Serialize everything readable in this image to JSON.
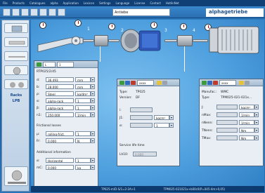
{
  "menu": [
    "File",
    "Products",
    "Catalogues",
    "alpha",
    "Application",
    "Lexicon",
    "Settings",
    "Language",
    "License",
    "Contact",
    "HotlinNet"
  ],
  "toolbar": {
    "project_select": "Antiebe",
    "brand": "alphagetriebe"
  },
  "sidebar": {
    "items": [
      "motor-tab",
      "coupling-tab",
      "shaft-tab",
      "gear-tab",
      "pulley-tab"
    ],
    "label1": "Racks",
    "label2": "LPB"
  },
  "drive": {
    "nodes": [
      "1",
      "2",
      "3",
      "4",
      "5"
    ]
  },
  "panel1": {
    "selector": "L",
    "selector_index": "1",
    "product": "RTP025/2/45",
    "rows": [
      {
        "label": "d:",
        "value": "36.493",
        "unit": "mm"
      },
      {
        "label": "b:",
        "value": "28.000",
        "unit": "mm"
      },
      {
        "label": "ρ:",
        "value": "Steel",
        "unit": "kg/dm³"
      },
      {
        "label": "α:",
        "value": "alpha-rack",
        "unit": "1"
      },
      {
        "label": "β:",
        "value": "alpha-rack",
        "unit": "1"
      },
      {
        "label": "n1:",
        "value": "250.000",
        "unit": "1/min"
      }
    ],
    "friction_title": "Frictional losses",
    "friction_rows": [
      {
        "label": "μ:",
        "value": "rolling-frict.",
        "unit": "1"
      },
      {
        "label": "Fr:",
        "value": "0.000",
        "unit": "N"
      }
    ],
    "additional_title": "Additional information",
    "additional_rows": [
      {
        "label": "α:",
        "value": "Horizontal",
        "unit": "1"
      },
      {
        "label": "mC:",
        "value": "0.000",
        "unit": "kg"
      }
    ]
  },
  "panel2": {
    "selector": "xxxx",
    "type_label": "Type:",
    "type_value": "TP025",
    "version_label": "Version:",
    "version_value": "DF",
    "rows": [
      {
        "label": "i:",
        "value": "",
        "unit": ""
      },
      {
        "label": "J1:",
        "value": "",
        "unit": "kgcm²"
      },
      {
        "label": "α:",
        "value": "",
        "unit": "1"
      }
    ],
    "service_label": "Service life time",
    "l10_label": "Lh10:",
    "l10_value": "0.000"
  },
  "panel3": {
    "selector": "xxxx",
    "manufacturer_label": "Manufac.:",
    "manufacturer_value": "WMC",
    "type_label": "Type:",
    "type_value": "TPM025-021-021x...",
    "rows": [
      {
        "label": "J:",
        "value": "",
        "unit": "kgcm²"
      },
      {
        "label": "nMax:",
        "value": "",
        "unit": "1/min"
      },
      {
        "label": "nNenn:",
        "value": "",
        "unit": "1/min"
      },
      {
        "label": "TNenn:",
        "value": "",
        "unit": "Nm"
      },
      {
        "label": "TMax:",
        "value": "",
        "unit": "Nm"
      }
    ]
  },
  "status": {
    "left": "TP025-m/D-S/1=2-2A>1",
    "right": "TPM025-021021x+b00c0(P=045-4m>0,05)"
  }
}
